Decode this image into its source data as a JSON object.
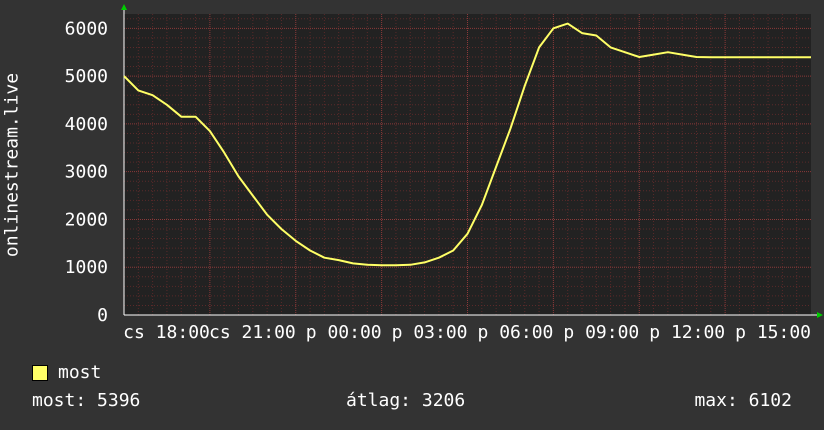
{
  "chart_data": {
    "type": "line",
    "ylabel": "onlinestream.live",
    "ylim": [
      0,
      6300
    ],
    "yticks": [
      0,
      1000,
      2000,
      3000,
      4000,
      5000,
      6000
    ],
    "xticks": [
      "cs 18:00",
      "cs 21:00",
      "p 00:00",
      "p 03:00",
      "p 06:00",
      "p 09:00",
      "p 12:00",
      "p 15:00"
    ],
    "grid": true,
    "series": [
      {
        "name": "most",
        "color": "#ffff66",
        "x": [
          0,
          0.5,
          1,
          1.5,
          2,
          2.5,
          3,
          3.5,
          4,
          4.5,
          5,
          5.5,
          6,
          6.5,
          7,
          7.5,
          8,
          8.5,
          9,
          9.5,
          10,
          10.5,
          11,
          11.5,
          12,
          12.5,
          13,
          13.5,
          14,
          14.5,
          15,
          15.5,
          16,
          16.5,
          17,
          17.5,
          18,
          18.5,
          19,
          19.5,
          20,
          20.5,
          21,
          21.5,
          22,
          22.5,
          23,
          23.5,
          24
        ],
        "values": [
          5000,
          4700,
          4600,
          4400,
          4150,
          4150,
          3850,
          3400,
          2900,
          2500,
          2100,
          1800,
          1550,
          1350,
          1200,
          1150,
          1080,
          1050,
          1040,
          1040,
          1050,
          1100,
          1200,
          1350,
          1700,
          2300,
          3100,
          3900,
          4800,
          5600,
          6000,
          6100,
          5900,
          5850,
          5600,
          5500,
          5400,
          5450,
          5500,
          5450,
          5400,
          5396,
          5396,
          5396,
          5396,
          5396,
          5396,
          5396,
          5396
        ]
      }
    ]
  },
  "legend": {
    "label": "most",
    "color": "#ffff66"
  },
  "stats": {
    "now": "most: 5396",
    "avg": "átlag: 3206",
    "max": "max: 6102"
  }
}
